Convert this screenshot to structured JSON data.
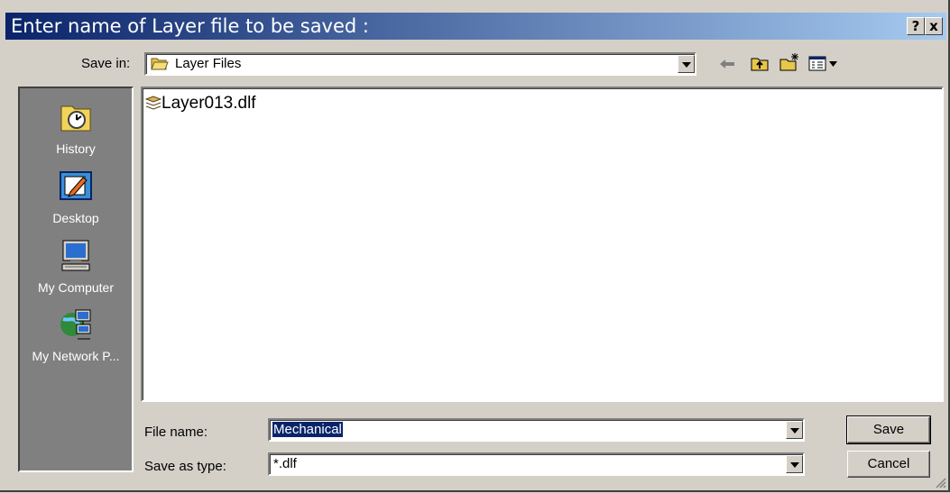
{
  "window": {
    "title": "Enter name of Layer file to be saved :",
    "help_label": "?",
    "close_label": "x"
  },
  "toolbar": {
    "save_in_label": "Save in:",
    "save_in_value": "Layer Files",
    "icons": [
      "back-arrow-icon",
      "up-one-level-icon",
      "new-folder-icon",
      "view-menu-icon"
    ]
  },
  "places": [
    {
      "label": "History",
      "icon": "history-icon"
    },
    {
      "label": "Desktop",
      "icon": "desktop-icon"
    },
    {
      "label": "My Computer",
      "icon": "my-computer-icon"
    },
    {
      "label": "My Network P...",
      "icon": "my-network-places-icon"
    }
  ],
  "files": [
    {
      "name": "Layer013.dlf",
      "icon": "layer-file-icon"
    }
  ],
  "filename": {
    "label": "File name:",
    "value": "Mechanical"
  },
  "filetype": {
    "label": "Save as type:",
    "value": "*.dlf"
  },
  "buttons": {
    "save": "Save",
    "cancel": "Cancel"
  },
  "colors": {
    "titlebar_start": "#0a246a",
    "titlebar_end": "#a6caf0",
    "face": "#d4d0c8",
    "selection": "#0a246a"
  }
}
